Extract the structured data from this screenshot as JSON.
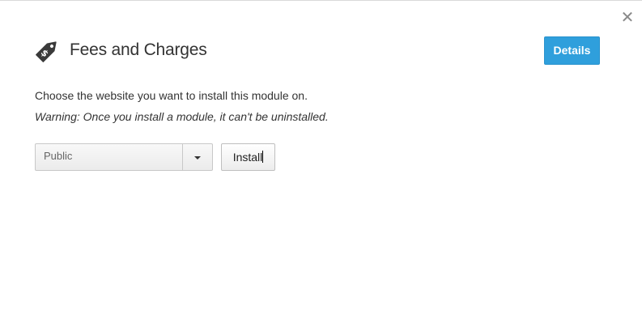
{
  "dialog": {
    "close_glyph": "✕",
    "title": "Fees and Charges",
    "title_icon": "price-tag-icon",
    "details_label": "Details",
    "instruction": "Choose the website you want to install this module on.",
    "warning": "Warning: Once you install a module, it can't be uninstalled.",
    "website_select": {
      "selected": "Public"
    },
    "install_label": "Install"
  },
  "colors": {
    "accent": "#2f9fdc",
    "text": "#333333",
    "icon": "#3a3a3a"
  }
}
